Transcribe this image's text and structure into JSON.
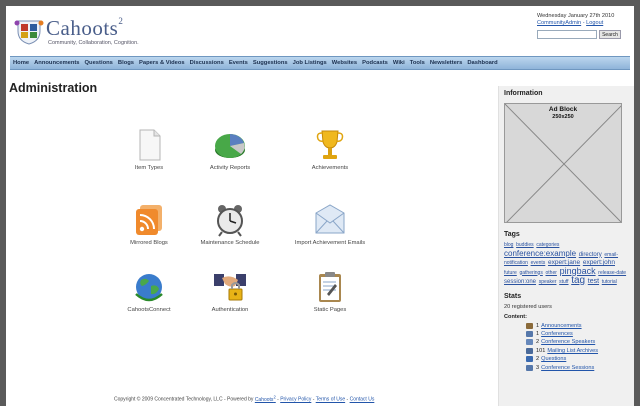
{
  "header": {
    "logo_name": "Cahoots",
    "logo_sup": "2",
    "tagline": "Community, Collaboration, Cognition.",
    "date": "Wednesday January 27th 2010",
    "user_link": "CommunityAdmin",
    "separator": " - ",
    "logout_link": "Logout",
    "search_placeholder": "",
    "search_button": "Search"
  },
  "nav": [
    "Home",
    "Announcements",
    "Questions",
    "Blogs",
    "Papers & Videos",
    "Discussions",
    "Events",
    "Suggestions",
    "Job Listings",
    "Websites",
    "Podcasts",
    "Wiki",
    "Tools",
    "Newsletters",
    "Dashboard"
  ],
  "main": {
    "title": "Administration",
    "tiles": [
      {
        "label": "Item Types",
        "icon": "document-icon"
      },
      {
        "label": "Activity Reports",
        "icon": "pie-chart-icon"
      },
      {
        "label": "Achievements",
        "icon": "trophy-icon"
      },
      {
        "label": "Mirrored Blogs",
        "icon": "rss-icon"
      },
      {
        "label": "Maintenance Schedule",
        "icon": "alarm-clock-icon"
      },
      {
        "label": "Import Achievement Emails",
        "icon": "envelope-icon"
      },
      {
        "label": "CahootsConnect",
        "icon": "globe-icon"
      },
      {
        "label": "Authentication",
        "icon": "handshake-lock-icon"
      },
      {
        "label": "Static Pages",
        "icon": "clipboard-icon"
      }
    ]
  },
  "footer": {
    "copyright": "Copyright © 2009 Concentrated Technology, LLC - Powered by ",
    "powered_link": "Cahoots",
    "powered_sup": "2",
    "sep1": " - ",
    "privacy": "Privacy Policy",
    "sep2": " - ",
    "terms": "Terms of Use",
    "sep3": " - ",
    "contact": "Contact Us"
  },
  "sidebar": {
    "info_heading": "Information",
    "ad_title": "Ad Block",
    "ad_size": "250x250",
    "tags_heading": "Tags",
    "tags": [
      {
        "text": "blog",
        "size": 5
      },
      {
        "text": "buddies",
        "size": 5
      },
      {
        "text": "categories",
        "size": 5
      },
      {
        "text": "conference:example",
        "size": 8
      },
      {
        "text": "directory",
        "size": 6
      },
      {
        "text": "email-notification",
        "size": 5
      },
      {
        "text": "events",
        "size": 5
      },
      {
        "text": "expert:jane",
        "size": 6.5
      },
      {
        "text": "expert:john",
        "size": 6.5
      },
      {
        "text": "future",
        "size": 5
      },
      {
        "text": "gatherings",
        "size": 5
      },
      {
        "text": "other",
        "size": 5
      },
      {
        "text": "pingback",
        "size": 9
      },
      {
        "text": "release-date",
        "size": 5
      },
      {
        "text": "session:one",
        "size": 6
      },
      {
        "text": "speaker",
        "size": 5
      },
      {
        "text": "stuff",
        "size": 5
      },
      {
        "text": "tag",
        "size": 10
      },
      {
        "text": "test",
        "size": 7
      },
      {
        "text": "tutorial",
        "size": 5
      }
    ],
    "stats_heading": "Stats",
    "registered_users": "20 registered users",
    "content_heading": "Content:",
    "content": [
      {
        "count": "1",
        "label": "Announcements",
        "color": "#8a6a3a"
      },
      {
        "count": "1",
        "label": "Conferences",
        "color": "#5577aa"
      },
      {
        "count": "2",
        "label": "Conference Speakers",
        "color": "#6688bb"
      },
      {
        "count": "101",
        "label": "Mailing List Archives",
        "color": "#4a6a9a"
      },
      {
        "count": "2",
        "label": "Questions",
        "color": "#3a6ab0"
      },
      {
        "count": "3",
        "label": "Conference Sessions",
        "color": "#5577aa"
      }
    ]
  }
}
